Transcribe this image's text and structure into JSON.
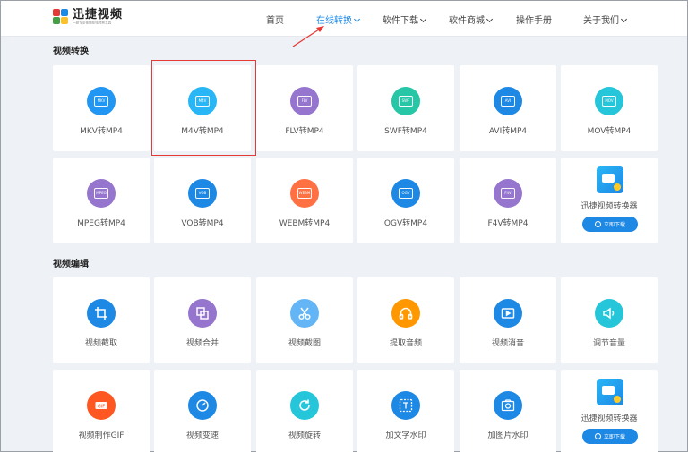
{
  "brand": {
    "name": "迅捷视频",
    "slogan": "一款专业视频在线转换工具"
  },
  "nav": [
    {
      "label": "首页",
      "dropdown": false,
      "active": false
    },
    {
      "label": "在线转换",
      "dropdown": true,
      "active": true
    },
    {
      "label": "软件下载",
      "dropdown": true,
      "active": false
    },
    {
      "label": "软件商城",
      "dropdown": true,
      "active": false
    },
    {
      "label": "操作手册",
      "dropdown": false,
      "active": false
    },
    {
      "label": "关于我们",
      "dropdown": true,
      "active": false
    }
  ],
  "sections": {
    "convert": {
      "title": "视频转换"
    },
    "edit": {
      "title": "视频编辑"
    }
  },
  "convert_items": [
    {
      "label": "MKV转MP4",
      "badge": "MKV",
      "color": "#2196f3"
    },
    {
      "label": "M4V转MP4",
      "badge": "M4V",
      "color": "#29b6f6"
    },
    {
      "label": "FLV转MP4",
      "badge": "FLV",
      "color": "#9575cd"
    },
    {
      "label": "SWF转MP4",
      "badge": "SWF",
      "color": "#26c6a6"
    },
    {
      "label": "AVI转MP4",
      "badge": "AVI",
      "color": "#1e88e5"
    },
    {
      "label": "MOV转MP4",
      "badge": "MOV",
      "color": "#26c6da"
    },
    {
      "label": "MPEG转MP4",
      "badge": "MPEG",
      "color": "#9575cd"
    },
    {
      "label": "VOB转MP4",
      "badge": "VOB",
      "color": "#1e88e5"
    },
    {
      "label": "WEBM转MP4",
      "badge": "WEBM",
      "color": "#ff7043"
    },
    {
      "label": "OGV转MP4",
      "badge": "OGV",
      "color": "#1e88e5"
    },
    {
      "label": "F4V转MP4",
      "badge": "F4V",
      "color": "#9575cd"
    }
  ],
  "edit_items": [
    {
      "label": "视频截取",
      "icon": "crop-icon",
      "color": "#1e88e5"
    },
    {
      "label": "视频合并",
      "icon": "merge-icon",
      "color": "#9575cd"
    },
    {
      "label": "视频截图",
      "icon": "scissors-icon",
      "color": "#64b5f6"
    },
    {
      "label": "提取音频",
      "icon": "headphones-icon",
      "color": "#ff9800"
    },
    {
      "label": "视频消音",
      "icon": "video-play-icon",
      "color": "#1e88e5"
    },
    {
      "label": "调节音量",
      "icon": "volume-icon",
      "color": "#26c6da"
    },
    {
      "label": "视频制作GIF",
      "icon": "gif-icon",
      "color": "#ff5722"
    },
    {
      "label": "视频变速",
      "icon": "speedometer-icon",
      "color": "#1e88e5"
    },
    {
      "label": "视频旋转",
      "icon": "rotate-icon",
      "color": "#26c6da"
    },
    {
      "label": "加文字水印",
      "icon": "text-watermark-icon",
      "color": "#1e88e5"
    },
    {
      "label": "加图片水印",
      "icon": "image-watermark-icon",
      "color": "#1e88e5"
    }
  ],
  "promo": {
    "title": "迅捷视频转换器",
    "button": "立即下载"
  },
  "colors": {
    "accent": "#1e88e5",
    "highlight": "#e53935"
  }
}
